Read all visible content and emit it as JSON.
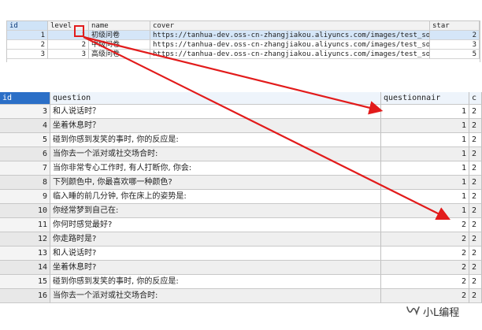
{
  "top_table": {
    "columns": [
      "id",
      "level",
      "name",
      "cover",
      "star"
    ],
    "rows": [
      {
        "id": "1",
        "level": "1",
        "name": "初级问卷",
        "cover": "https://tanhua-dev.oss-cn-zhangjiakou.aliyuncs.com/images/test_soul",
        "star": "2"
      },
      {
        "id": "2",
        "level": "2",
        "name": "中级问卷",
        "cover": "https://tanhua-dev.oss-cn-zhangjiakou.aliyuncs.com/images/test_soul",
        "star": "3"
      },
      {
        "id": "3",
        "level": "3",
        "name": "高级问卷",
        "cover": "https://tanhua-dev.oss-cn-zhangjiakou.aliyuncs.com/images/test_soul",
        "star": "5"
      }
    ]
  },
  "bottom_table": {
    "columns": [
      "id",
      "question",
      "questionnair",
      "c"
    ],
    "rows": [
      {
        "id": "3",
        "question": "和人说话时？",
        "questionnair": "1",
        "extra": "2"
      },
      {
        "id": "4",
        "question": "坐着休息时？",
        "questionnair": "1",
        "extra": "2"
      },
      {
        "id": "5",
        "question": "碰到你感到发笑的事时, 你的反应是:",
        "questionnair": "1",
        "extra": "2"
      },
      {
        "id": "6",
        "question": "当你去一个派对或社交场合时:",
        "questionnair": "1",
        "extra": "2"
      },
      {
        "id": "7",
        "question": "当你非常专心工作时, 有人打断你, 你会:",
        "questionnair": "1",
        "extra": "2"
      },
      {
        "id": "8",
        "question": "下列颜色中, 你最喜欢哪一种颜色?",
        "questionnair": "1",
        "extra": "2"
      },
      {
        "id": "9",
        "question": "临入睡的前几分钟, 你在床上的姿势是:",
        "questionnair": "1",
        "extra": "2"
      },
      {
        "id": "10",
        "question": "你经常梦到自己在:",
        "questionnair": "1",
        "extra": "2"
      },
      {
        "id": "11",
        "question": "你何时感觉最好?",
        "questionnair": "2",
        "extra": "2"
      },
      {
        "id": "12",
        "question": "你走路时是?",
        "questionnair": "2",
        "extra": "2"
      },
      {
        "id": "13",
        "question": "和人说话时?",
        "questionnair": "2",
        "extra": "2"
      },
      {
        "id": "14",
        "question": "坐着休息时?",
        "questionnair": "2",
        "extra": "2"
      },
      {
        "id": "15",
        "question": "碰到你感到发笑的事时, 你的反应是:",
        "questionnair": "2",
        "extra": "2"
      },
      {
        "id": "16",
        "question": "当你去一个派对或社交场合时:",
        "questionnair": "2",
        "extra": "2"
      }
    ]
  },
  "watermark": {
    "text": "小L编程",
    "icon": "wechat-channel-icon"
  },
  "colors": {
    "arrow": "#e21b1b",
    "header_selected": "#2b6fc7",
    "row_selected": "#d5e6f8"
  }
}
